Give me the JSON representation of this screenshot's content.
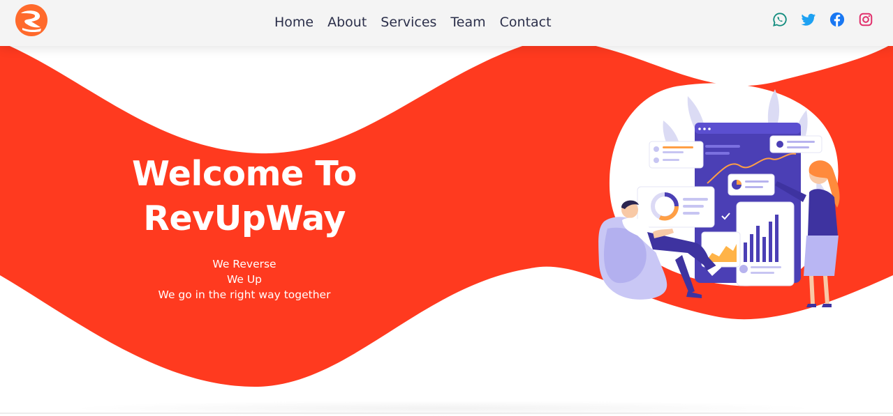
{
  "brand": {
    "logo_icon": "revupway-logo-icon",
    "accent_color": "#ff3a1f"
  },
  "nav": {
    "links": [
      {
        "label": "Home"
      },
      {
        "label": "About"
      },
      {
        "label": "Services"
      },
      {
        "label": "Team"
      },
      {
        "label": "Contact"
      }
    ]
  },
  "socials": [
    {
      "icon": "whatsapp-icon",
      "color": "#128c7e"
    },
    {
      "icon": "twitter-icon",
      "color": "#1da1f2"
    },
    {
      "icon": "facebook-icon",
      "color": "#1877f2"
    },
    {
      "icon": "instagram-icon",
      "color": "#e1306c"
    }
  ],
  "hero": {
    "title": "Welcome To RevUpWay",
    "tagline": [
      "We Reverse",
      "We Up",
      "We go in the right way together"
    ],
    "illustration": "analytics-dashboard-illustration"
  }
}
